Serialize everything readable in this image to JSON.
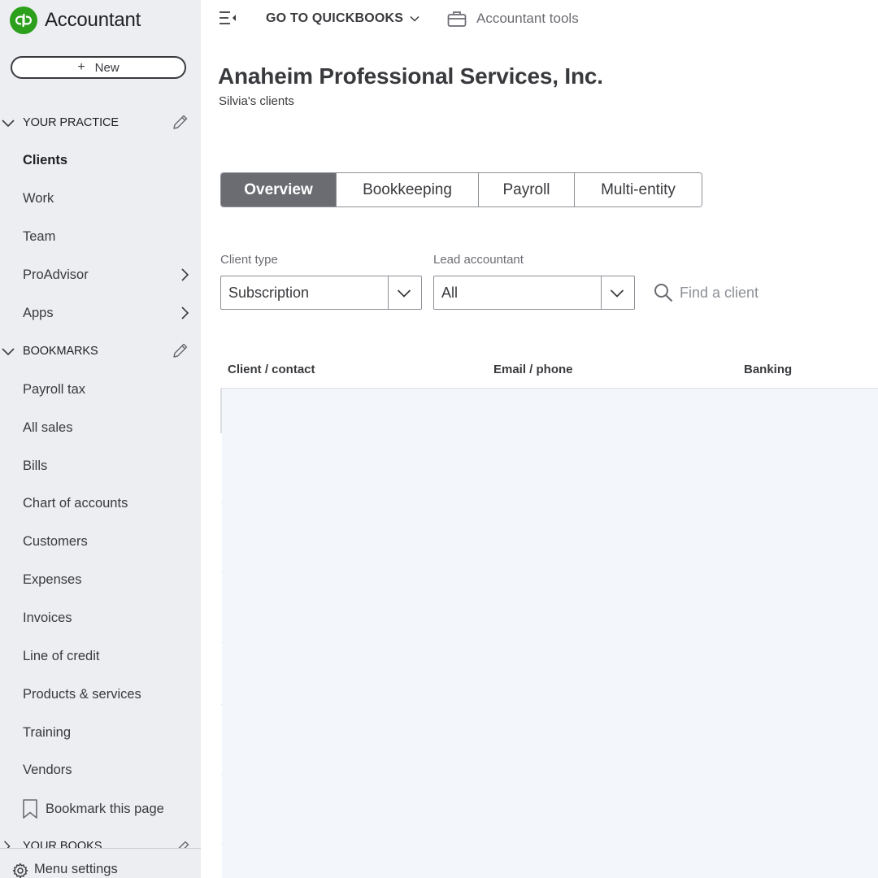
{
  "app": {
    "logo_icon": "quickbooks-logo-icon",
    "brand_color": "#2ca01c",
    "title": "Accountant"
  },
  "sidebar": {
    "new_button": {
      "icon": "+",
      "label": "New"
    },
    "your_practice": {
      "title": "YOUR PRACTICE",
      "items": [
        {
          "label": "Clients",
          "active": true
        },
        {
          "label": "Work"
        },
        {
          "label": "Team"
        },
        {
          "label": "ProAdvisor",
          "has_submenu": true
        },
        {
          "label": "Apps",
          "has_submenu": true
        }
      ]
    },
    "bookmarks": {
      "title": "BOOKMARKS",
      "items": [
        {
          "label": "Payroll tax"
        },
        {
          "label": "All sales"
        },
        {
          "label": "Bills"
        },
        {
          "label": "Chart of accounts"
        },
        {
          "label": "Customers"
        },
        {
          "label": "Expenses"
        },
        {
          "label": "Invoices"
        },
        {
          "label": "Line of credit"
        },
        {
          "label": "Products & services"
        },
        {
          "label": "Training"
        },
        {
          "label": "Vendors"
        }
      ],
      "bookmark_page_label": "Bookmark this page"
    },
    "your_books": {
      "title": "YOUR BOOKS"
    },
    "menu_settings_label": "Menu settings"
  },
  "topbar": {
    "goto_label": "GO TO QUICKBOOKS",
    "accountant_tools_label": "Accountant tools"
  },
  "main": {
    "company_name": "Anaheim Professional Services, Inc.",
    "subtitle": "Silvia's clients",
    "tabs": [
      {
        "label": "Overview",
        "active": true
      },
      {
        "label": "Bookkeeping"
      },
      {
        "label": "Payroll"
      },
      {
        "label": "Multi-entity"
      }
    ],
    "filters": {
      "client_type": {
        "label": "Client type",
        "value": "Subscription"
      },
      "lead_accountant": {
        "label": "Lead accountant",
        "value": "All"
      },
      "search_placeholder": "Find a client"
    },
    "table": {
      "columns": [
        "Client / contact",
        "Email / phone",
        "Banking"
      ]
    }
  }
}
